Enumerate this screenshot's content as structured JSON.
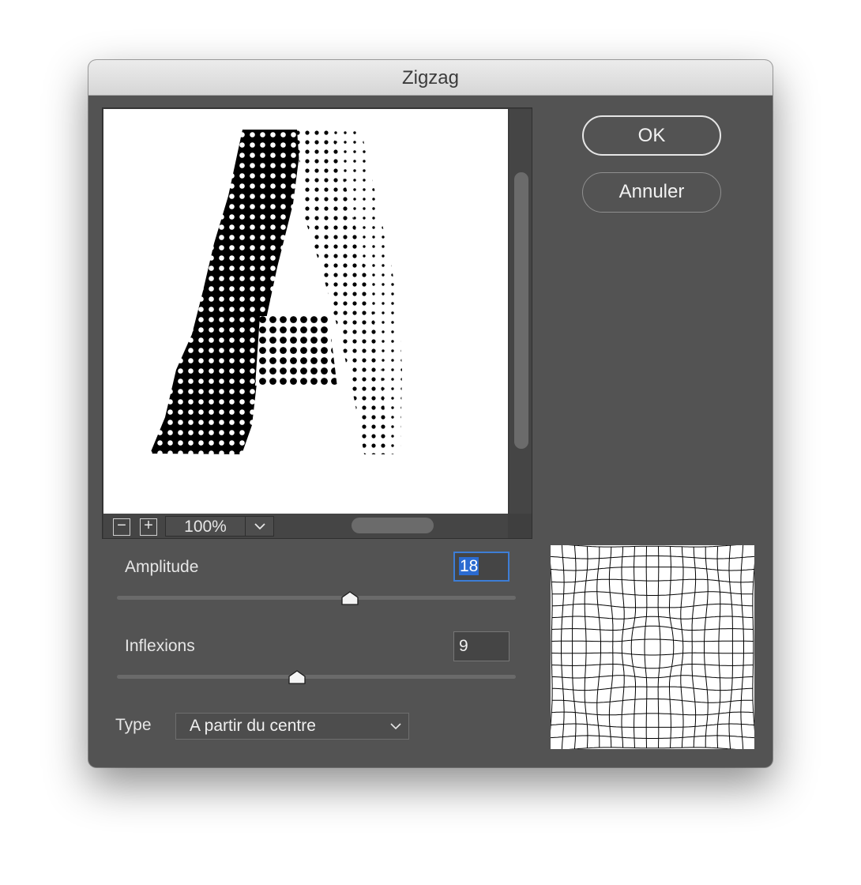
{
  "window": {
    "title": "Zigzag"
  },
  "preview": {
    "zoom_out": "−",
    "zoom_in": "+",
    "zoom_level": "100%"
  },
  "buttons": {
    "ok": "OK",
    "cancel": "Annuler"
  },
  "amplitude": {
    "label": "Amplitude",
    "value": "18",
    "slider_fraction": 0.59
  },
  "inflexions": {
    "label": "Inflexions",
    "value": "9",
    "slider_fraction": 0.45
  },
  "type": {
    "label": "Type",
    "selected": "A partir du centre"
  },
  "colors": {
    "dialog_bg": "#535353",
    "focus_ring": "#3d7dd6"
  },
  "icons": [
    "zoom-out-icon",
    "zoom-in-icon",
    "chevron-down-icon",
    "slider-thumb-icon"
  ]
}
